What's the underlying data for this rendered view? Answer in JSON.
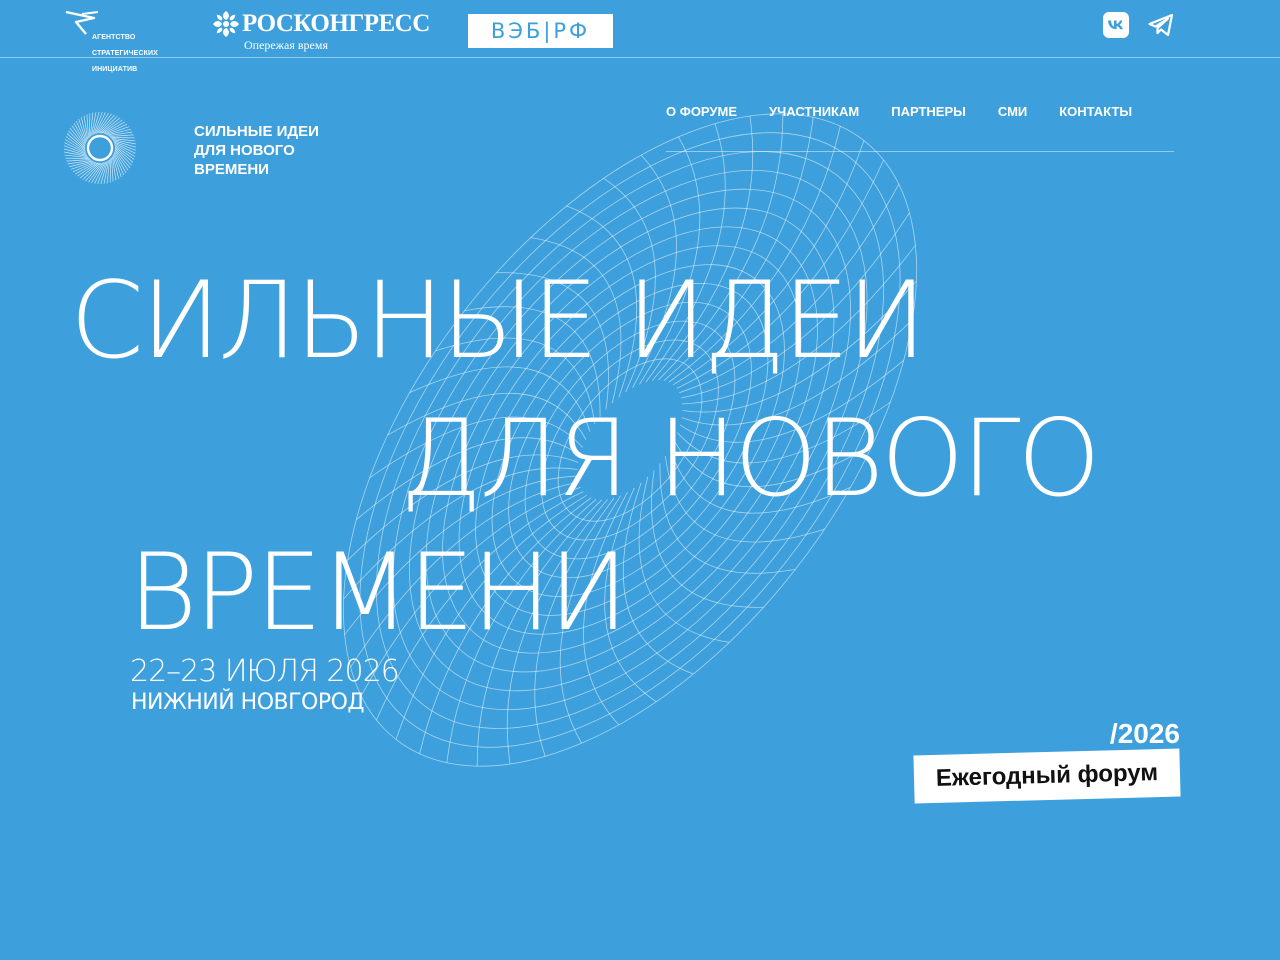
{
  "brand": {
    "background": "#3da0dc",
    "foreground": "#ffffff"
  },
  "partners": {
    "asi": {
      "line1": "АГЕНТСТВО",
      "line2": "СТРАТЕГИЧЕСКИХ",
      "line3": "ИНИЦИАТИВ",
      "icon": "asi-logo-icon"
    },
    "roscongress": {
      "title": "РОСКОНГРЕСС",
      "subtitle": "Опережая время",
      "icon": "roscongress-logo-icon"
    },
    "veb": {
      "label": "ВЭБ|РФ"
    }
  },
  "social": {
    "vk_icon": "vk-icon",
    "telegram_icon": "telegram-icon"
  },
  "header": {
    "logo_lines": [
      "СИЛЬНЫЕ ИДЕИ",
      "ДЛЯ НОВОГО",
      "ВРЕМЕНИ"
    ],
    "nav": [
      {
        "label": "О ФОРУМЕ"
      },
      {
        "label": "УЧАСТНИКАМ"
      },
      {
        "label": "ПАРТНЕРЫ"
      },
      {
        "label": "СМИ"
      },
      {
        "label": "КОНТАКТЫ"
      }
    ]
  },
  "hero": {
    "lines": [
      "СИЛЬНЫЕ ИДЕИ",
      "ДЛЯ НОВОГО",
      "ВРЕМЕНИ"
    ],
    "date": "22–23 ИЮЛЯ 2026",
    "city": "НИЖНИЙ НОВГОРОД",
    "year": "/2026",
    "badge": "Ежегодный форум"
  }
}
